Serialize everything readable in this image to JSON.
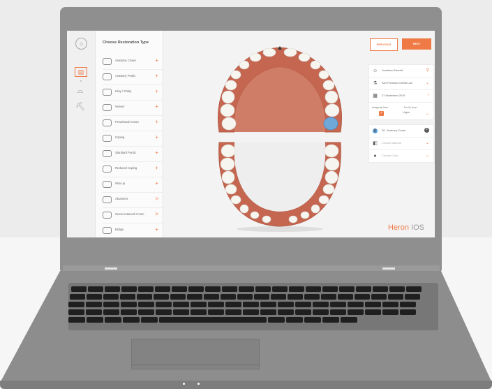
{
  "colors": {
    "accent": "#EF7A46",
    "tooth_selected": "#6EA8D8"
  },
  "sidebar": {
    "icons": [
      "home-icon",
      "tablet-icon",
      "upper-jaw-icon",
      "implant-icon"
    ]
  },
  "restoration_panel": {
    "title": "Choose Restoration Type",
    "items": [
      {
        "label": "Anatomy Crown",
        "action": "+"
      },
      {
        "label": "Anatomy Pontic",
        "action": "+"
      },
      {
        "label": "Inlay / Onlay",
        "action": "+"
      },
      {
        "label": "Veneer",
        "action": "+"
      },
      {
        "label": "Provisional Crown",
        "action": "+"
      },
      {
        "label": "Coping",
        "action": "+"
      },
      {
        "label": "Standard Pontic",
        "action": "+"
      },
      {
        "label": "Reduced Coping",
        "action": "+"
      },
      {
        "label": "Wax up",
        "action": "+"
      },
      {
        "label": "Abutment",
        "action": ">"
      },
      {
        "label": "Screw-retained Crown",
        "action": ">"
      },
      {
        "label": "Bridge",
        "action": "+"
      }
    ]
  },
  "nav": {
    "previous": "PREVIOUS",
    "next": "NEXT"
  },
  "case_info": {
    "patient": "Jonathan Schmidt",
    "lab": "San Francisco Dental Lab",
    "date": "21 September 2019",
    "antagonist_label": "Antagonist Scan",
    "preop_label": "Pre-Op Scan",
    "jaw_value": "Upper"
  },
  "order": {
    "tooth_number": "8",
    "tooth_label": "28 - Anatomy Crown",
    "material_placeholder": "Choose Material",
    "color_placeholder": "Choose Color"
  },
  "brand": {
    "part1": "Heron",
    "part2": " IOS"
  }
}
